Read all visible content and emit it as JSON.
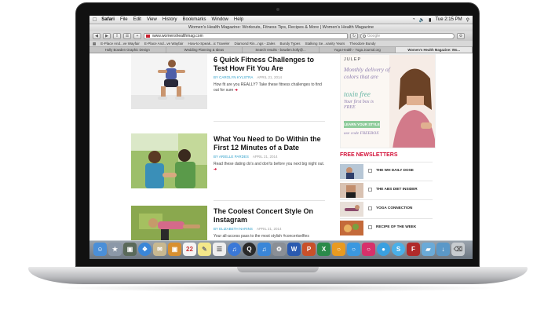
{
  "menubar": {
    "app": "Safari",
    "items": [
      "File",
      "Edit",
      "View",
      "History",
      "Bookmarks",
      "Window",
      "Help"
    ],
    "clock": "Tue 2:15 PM"
  },
  "window": {
    "title": "Women's Health Magazine: Workouts, Fitness Tips, Recipes & More | Women's Health Magazine",
    "url": "www.womenshealthmag.com",
    "search_placeholder": "Google"
  },
  "bookmarks": [
    "E-Place And...ve Wayfair",
    "E-Place And...ve Wayfair",
    "How-to-Speak...ic Traveler",
    "Diamond Rin...ngs - Zales",
    "Bundy Types",
    "Stalking Se...vanity Years",
    "Theodore Bundy"
  ],
  "tabs": [
    {
      "label": "Holly Bowden Graphic Design",
      "active": false
    },
    {
      "label": "Wedding Planning & Ideas",
      "active": false
    },
    {
      "label": "Search results - bowden.holly@...",
      "active": false
    },
    {
      "label": "Yoga Health - Yoga Journal.org",
      "active": false
    },
    {
      "label": "Women's Health Magazine: Wo...",
      "active": true
    }
  ],
  "articles": [
    {
      "title": "6 Quick Fitness Challenges to Test How Fit You Are",
      "author": "BY CAROLYN KYLSTRA",
      "date": "APRIL 21, 2014",
      "teaser": "How fit are you REALLY? Take these fitness challenges to find out for sure"
    },
    {
      "title": "What You Need to Do Within the First 12 Minutes of a Date",
      "author": "BY ARIELLE PARDES",
      "date": "APRIL 21, 2014",
      "teaser": "Read these dating do's and don'ts before you next big night out."
    },
    {
      "title": "The Coolest Concert Style On Instagram",
      "author": "BY ELIZABETH NARINS",
      "date": "APRIL 21, 2014",
      "teaser": "Your all-access pass to the most stylish #concertselfies"
    }
  ],
  "ad": {
    "brand": "JULEP",
    "headline": "Monthly delivery of colors that are",
    "script": "toxin free",
    "small": "Your first box is FREE",
    "button": "LEARN YOUR STYLE",
    "code": "use code FREEBOX"
  },
  "newsletters": {
    "heading": "FREE NEWSLETTERS",
    "items": [
      "THE WH DAILY DOSE",
      "THE ABS DIET INSIDER",
      "YOGA CONNECTION",
      "RECIPE OF THE WEEK"
    ]
  },
  "colors": {
    "accent_red": "#d4143b",
    "author_blue": "#2c9ec9",
    "ad_purple": "#8c7cae",
    "ad_green": "#8fcc9c"
  },
  "dock_icons": [
    "finder-icon",
    "launchpad-icon",
    "photo-icon",
    "safari-icon",
    "mail-icon",
    "preview-icon",
    "calendar-icon",
    "notes-icon",
    "reminders-icon",
    "itunes-icon",
    "quicktime-icon",
    "itunes-store-icon",
    "system-prefs-icon",
    "word-icon",
    "powerpoint-icon",
    "excel-icon",
    "illustrator-icon",
    "photoshop-icon",
    "indesign-icon",
    "messages-icon",
    "skype-icon",
    "filezilla-icon",
    "folder-icon",
    "downloads-icon",
    "trash-icon"
  ]
}
